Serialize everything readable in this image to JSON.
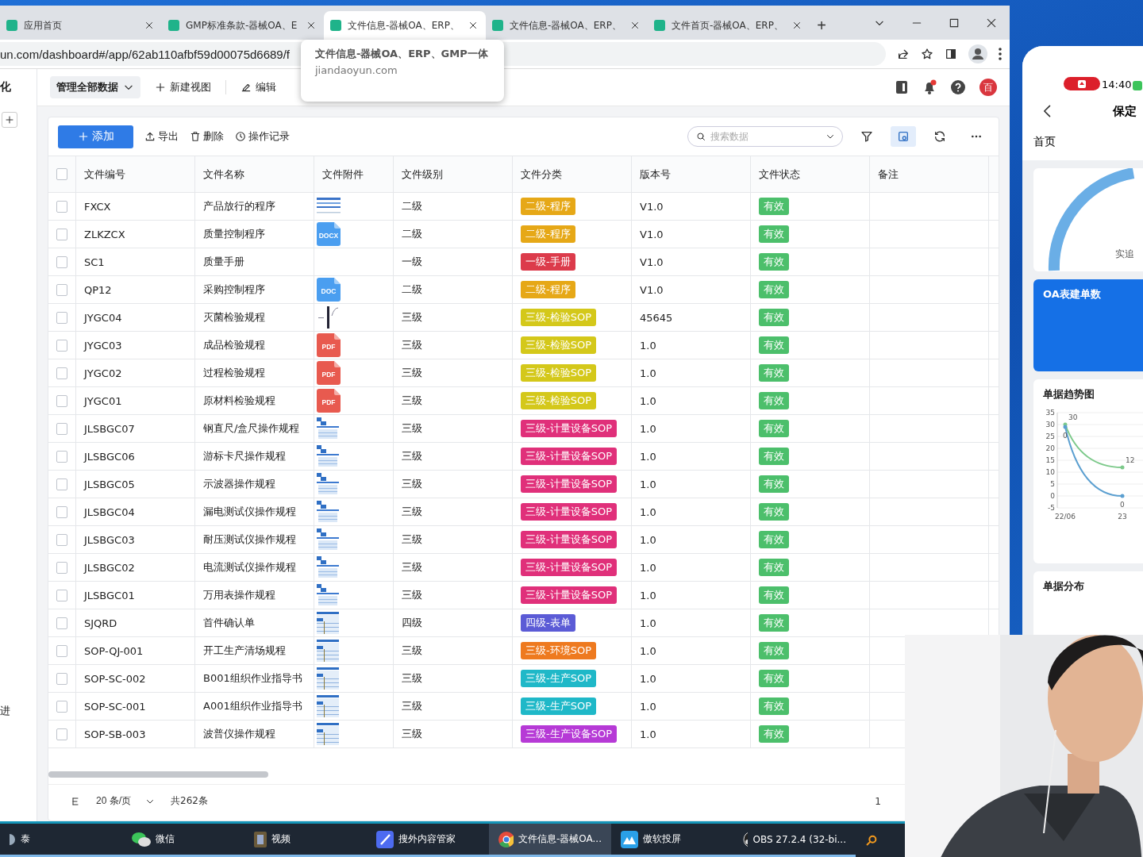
{
  "browser": {
    "tabs": [
      {
        "title": "应用首页",
        "selected": false
      },
      {
        "title": "GMP标准条款-器械OA、E",
        "selected": false
      },
      {
        "title": "文件信息-器械OA、ERP、",
        "selected": true
      },
      {
        "title": "文件信息-器械OA、ERP、",
        "selected": false
      },
      {
        "title": "文件首页-器械OA、ERP、",
        "selected": false
      }
    ],
    "new_tab": "+",
    "address": "un.com/dashboard#/app/62ab110afbf59d00075d6689/f",
    "tooltip": {
      "title": "文件信息-器械OA、ERP、GMP一体",
      "domain": "jiandaoyun.com"
    }
  },
  "sidebar": {
    "top_text": "化",
    "bottom_text": "进"
  },
  "header": {
    "view_selector": "管理全部数据",
    "new_view": "新建视图",
    "edit": "编辑",
    "avatar": "百",
    "has_notification": true
  },
  "toolbar": {
    "add": "添加",
    "actions": [
      {
        "kind": "export",
        "label": "导出"
      },
      {
        "kind": "delete",
        "label": "删除"
      },
      {
        "kind": "history",
        "label": "操作记录"
      }
    ],
    "search": {
      "placeholder": "搜索数据"
    },
    "tools": [
      {
        "kind": "filter",
        "active": false
      },
      {
        "kind": "view",
        "active": true
      },
      {
        "kind": "refresh",
        "active": false
      },
      {
        "kind": "more",
        "active": false
      }
    ]
  },
  "table": {
    "all_checked": false,
    "columns": [
      "文件编号",
      "文件名称",
      "文件附件",
      "文件级别",
      "文件分类",
      "版本号",
      "文件状态",
      "备注"
    ],
    "rows": [
      {
        "checked": false,
        "code": "FXCX",
        "name": "产品放行的程序",
        "attachment": {
          "kind": "sheet"
        },
        "level_text": "二级",
        "category": {
          "text": "二级-程序",
          "color": "#e6a817"
        },
        "version": "V1.0",
        "status": "有效"
      },
      {
        "checked": false,
        "code": "ZLKZCX",
        "name": "质量控制程序",
        "attachment": {
          "kind": "file",
          "label": "DOCX",
          "color": "#4a9ef0"
        },
        "level_text": "二级",
        "category": {
          "text": "二级-程序",
          "color": "#e6a817"
        },
        "version": "V1.0",
        "status": "有效"
      },
      {
        "checked": false,
        "code": "SC1",
        "name": "质量手册",
        "level_text": "一级",
        "category": {
          "text": "一级-手册",
          "color": "#dc3b4b"
        },
        "version": "V1.0",
        "status": "有效"
      },
      {
        "checked": false,
        "code": "QP12",
        "name": "采购控制程序",
        "attachment": {
          "kind": "file",
          "label": "DOC",
          "color": "#4a9ef0"
        },
        "level_text": "二级",
        "category": {
          "text": "二级-程序",
          "color": "#e6a817"
        },
        "version": "V1.0",
        "status": "有效"
      },
      {
        "checked": false,
        "code": "JYGC04",
        "name": "灭菌检验规程",
        "attachment": {
          "kind": "drawing"
        },
        "level_text": "三级",
        "category": {
          "text": "三级-检验SOP",
          "color": "#d4c81a"
        },
        "version": "45645",
        "status": "有效"
      },
      {
        "checked": false,
        "code": "JYGC03",
        "name": "成品检验规程",
        "attachment": {
          "kind": "file",
          "label": "PDF",
          "color": "#e85a4f"
        },
        "level_text": "三级",
        "category": {
          "text": "三级-检验SOP",
          "color": "#d4c81a"
        },
        "version": "1.0",
        "status": "有效"
      },
      {
        "checked": false,
        "code": "JYGC02",
        "name": "过程检验规程",
        "attachment": {
          "kind": "file",
          "label": "PDF",
          "color": "#e85a4f"
        },
        "level_text": "三级",
        "category": {
          "text": "三级-检验SOP",
          "color": "#d4c81a"
        },
        "version": "1.0",
        "status": "有效"
      },
      {
        "checked": false,
        "code": "JYGC01",
        "name": "原材料检验规程",
        "attachment": {
          "kind": "file",
          "label": "PDF",
          "color": "#e85a4f"
        },
        "level_text": "三级",
        "category": {
          "text": "三级-检验SOP",
          "color": "#d4c81a"
        },
        "version": "1.0",
        "status": "有效"
      },
      {
        "checked": false,
        "code": "JLSBGC07",
        "name": "钢直尺/盒尺操作规程",
        "attachment": {
          "kind": "form"
        },
        "level_text": "三级",
        "category": {
          "text": "三级-计量设备SOP",
          "color": "#e0307a"
        },
        "version": "1.0",
        "status": "有效"
      },
      {
        "checked": false,
        "code": "JLSBGC06",
        "name": "游标卡尺操作规程",
        "attachment": {
          "kind": "form"
        },
        "level_text": "三级",
        "category": {
          "text": "三级-计量设备SOP",
          "color": "#e0307a"
        },
        "version": "1.0",
        "status": "有效"
      },
      {
        "checked": false,
        "code": "JLSBGC05",
        "name": "示波器操作规程",
        "attachment": {
          "kind": "form"
        },
        "level_text": "三级",
        "category": {
          "text": "三级-计量设备SOP",
          "color": "#e0307a"
        },
        "version": "1.0",
        "status": "有效"
      },
      {
        "checked": false,
        "code": "JLSBGC04",
        "name": "漏电测试仪操作规程",
        "attachment": {
          "kind": "form"
        },
        "level_text": "三级",
        "category": {
          "text": "三级-计量设备SOP",
          "color": "#e0307a"
        },
        "version": "1.0",
        "status": "有效"
      },
      {
        "checked": false,
        "code": "JLSBGC03",
        "name": "耐压测试仪操作规程",
        "attachment": {
          "kind": "form"
        },
        "level_text": "三级",
        "category": {
          "text": "三级-计量设备SOP",
          "color": "#e0307a"
        },
        "version": "1.0",
        "status": "有效"
      },
      {
        "checked": false,
        "code": "JLSBGC02",
        "name": "电流测试仪操作规程",
        "attachment": {
          "kind": "form"
        },
        "level_text": "三级",
        "category": {
          "text": "三级-计量设备SOP",
          "color": "#e0307a"
        },
        "version": "1.0",
        "status": "有效"
      },
      {
        "checked": false,
        "code": "JLSBGC01",
        "name": "万用表操作规程",
        "attachment": {
          "kind": "form"
        },
        "level_text": "三级",
        "category": {
          "text": "三级-计量设备SOP",
          "color": "#e0307a"
        },
        "version": "1.0",
        "status": "有效"
      },
      {
        "checked": false,
        "code": "SJQRD",
        "name": "首件确认单",
        "attachment": {
          "kind": "table"
        },
        "level_text": "四级",
        "category": {
          "text": "四级-表单",
          "color": "#5b5bd6"
        },
        "version": "1.0",
        "status": "有效"
      },
      {
        "checked": false,
        "code": "SOP-QJ-001",
        "name": "开工生产清场规程",
        "attachment": {
          "kind": "table"
        },
        "level_text": "三级",
        "category": {
          "text": "三级-环境SOP",
          "color": "#ee7a1f"
        },
        "version": "1.0",
        "status": "有效"
      },
      {
        "checked": false,
        "code": "SOP-SC-002",
        "name": "B001组织作业指导书",
        "attachment": {
          "kind": "table"
        },
        "level_text": "三级",
        "category": {
          "text": "三级-生产SOP",
          "color": "#1fb8c8"
        },
        "version": "1.0",
        "status": "有效"
      },
      {
        "checked": false,
        "code": "SOP-SC-001",
        "name": "A001组织作业指导书",
        "attachment": {
          "kind": "table"
        },
        "level_text": "三级",
        "category": {
          "text": "三级-生产SOP",
          "color": "#1fb8c8"
        },
        "version": "1.0",
        "status": "有效"
      },
      {
        "checked": false,
        "code": "SOP-SB-003",
        "name": "波普仪操作规程",
        "attachment": {
          "kind": "table"
        },
        "level_text": "三级",
        "category": {
          "text": "三级-生产设备SOP",
          "color": "#b63ad6"
        },
        "version": "1.0",
        "status": "有效"
      }
    ]
  },
  "pagination": {
    "page_size": "20 条/页",
    "total": "共262条",
    "page": "1"
  },
  "phone": {
    "time": "14:40",
    "title": "保定",
    "tab": "首页",
    "gauge_label": "实追",
    "blue_card": "OA表建单数",
    "trend_title": "单据趋势图",
    "chart_data": {
      "type": "line",
      "grid": true,
      "categories": [
        "22/06",
        "23"
      ],
      "ylim": [
        -5,
        35
      ],
      "yticks": [
        -5,
        0,
        5,
        10,
        15,
        20,
        25,
        30,
        35
      ],
      "series": [
        {
          "color": "#7cc98a",
          "values": [
            30,
            12
          ]
        },
        {
          "color": "#5b9fd0",
          "values": [
            29,
            0
          ]
        }
      ],
      "value_labels": [
        [
          "30",
          "12"
        ],
        [
          "0",
          "0"
        ]
      ]
    },
    "distribution_title": "单据分布"
  },
  "taskbar": [
    {
      "kind": "app",
      "label": "泰",
      "active": false
    },
    {
      "kind": "wechat",
      "label": "微信",
      "active": false
    },
    {
      "kind": "video",
      "label": "视频",
      "active": false
    },
    {
      "kind": "feather",
      "label": "搜外内容管家",
      "active": false
    },
    {
      "kind": "chrome",
      "label": "文件信息-器械OA...",
      "active": true
    },
    {
      "kind": "cast",
      "label": "傲软投屏",
      "active": false
    },
    {
      "kind": "obs",
      "label": "OBS 27.2.4 (32-bi...",
      "active": false
    },
    {
      "kind": "search",
      "active": false
    }
  ]
}
